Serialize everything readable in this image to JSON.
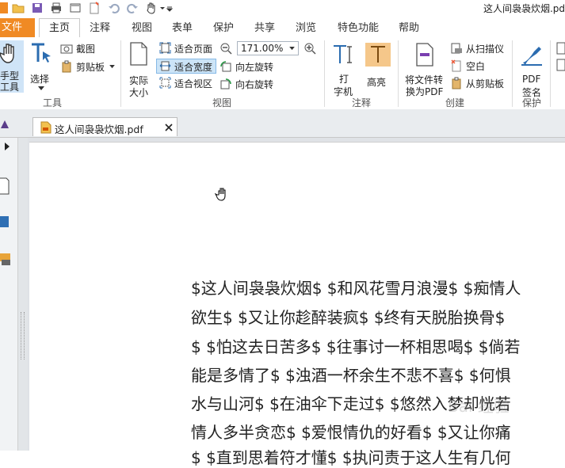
{
  "window": {
    "title": "这人间袅袅炊烟.pd"
  },
  "tabs": {
    "file": "文件",
    "items": [
      "主页",
      "注释",
      "视图",
      "表单",
      "保护",
      "共享",
      "浏览",
      "特色功能",
      "帮助"
    ]
  },
  "ribbon": {
    "tools": {
      "hand": "手型\n工具",
      "hand_line1": "手型",
      "hand_line2": "工具",
      "select": "选择",
      "screenshot": "截图",
      "clipboard": "剪贴板",
      "group": "工具"
    },
    "view": {
      "actual_size_1": "实际",
      "actual_size_2": "大小",
      "fit_page": "适合页面",
      "fit_width": "适合宽度",
      "fit_visible": "适合视区",
      "zoom_value": "171.00%",
      "rotate_left": "向左旋转",
      "rotate_right": "向右旋转",
      "group": "视图"
    },
    "annotate": {
      "typewriter_1": "打",
      "typewriter_2": "字机",
      "highlight": "高亮",
      "group": "注释"
    },
    "create": {
      "convert_1": "将文件转",
      "convert_2": "换为PDF",
      "from_scanner": "从扫描仪",
      "blank": "空白",
      "from_clipboard": "从剪贴板",
      "group": "创建"
    },
    "protect": {
      "sign_1": "PDF",
      "sign_2": "签名",
      "group": "保护"
    }
  },
  "document_tab": {
    "name": "这人间袅袅炊烟.pdf"
  },
  "document": {
    "lines": [
      "$这人间袅袅炊烟$ $和风花雪月浪漫$ $痴情人",
      "欲生$ $又让你趁醉装疯$ $终有天脱胎换骨$",
      "$ $怕这去日苦多$ $往事讨一杯相思喝$ $倘若",
      "能是多情了$ $浊酒一杯余生不悲不喜$ $何惧",
      "水与山河$ $在油伞下走过$ $悠然入梦却恍若",
      "情人多半贪恋$ $爱恨情仇的好看$ $又让你痛",
      "$ $直到思着符才懂$ $执问责于这人生有几何"
    ]
  },
  "watermark": "Bai 经验",
  "colors": {
    "accent": "#f08a24",
    "ribbon_blue": "#2b6cb0",
    "highlight_bg": "#f5c78a"
  }
}
